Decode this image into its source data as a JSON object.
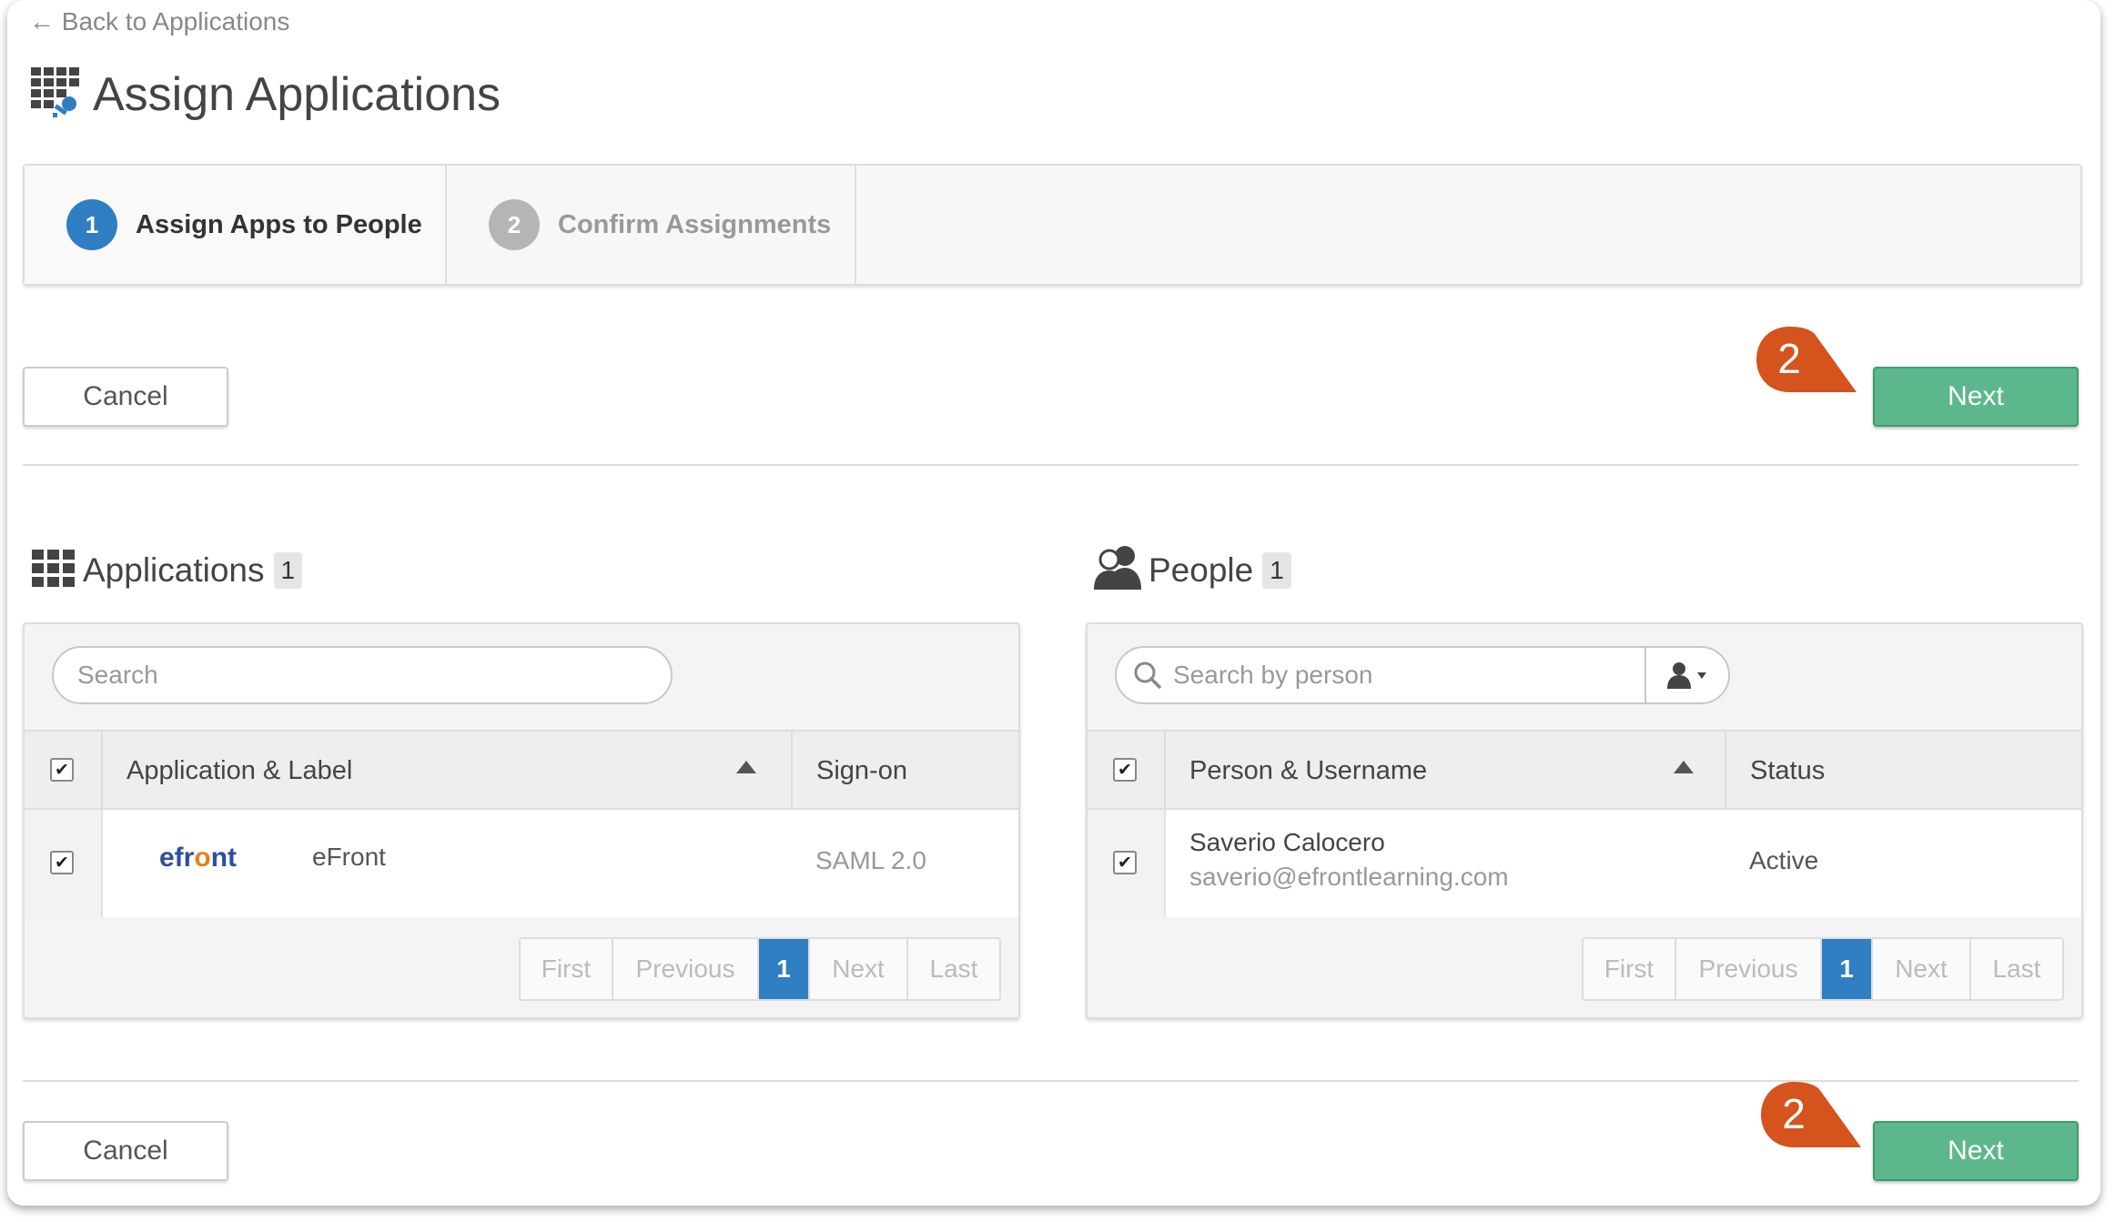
{
  "back_link": "← Back to Applications",
  "page_title": "Assign Applications",
  "wizard": {
    "steps": [
      {
        "num": "1",
        "label": "Assign Apps to People"
      },
      {
        "num": "2",
        "label": "Confirm Assignments"
      }
    ]
  },
  "actions": {
    "cancel": "Cancel",
    "next": "Next"
  },
  "callout_number": "2",
  "colors": {
    "accent_blue": "#2f7ec4",
    "next_green": "#5cb88c",
    "callout_orange": "#d5531d",
    "step_inactive": "#b5b5b5"
  },
  "applications": {
    "title": "Applications",
    "count": "1",
    "search_placeholder": "Search",
    "col_app": "Application & Label",
    "col_signon": "Sign-on",
    "row": {
      "logo_part1": "efr",
      "logo_part2": "o",
      "logo_part3": "nt",
      "label": "eFront",
      "signon": "SAML 2.0"
    }
  },
  "people": {
    "title": "People",
    "count": "1",
    "search_placeholder": "Search by person",
    "col_person": "Person & Username",
    "col_status": "Status",
    "row": {
      "name": "Saverio Calocero",
      "email": "saverio@efrontlearning.com",
      "status": "Active"
    }
  },
  "pagination": {
    "first": "First",
    "previous": "Previous",
    "page": "1",
    "next": "Next",
    "last": "Last"
  }
}
